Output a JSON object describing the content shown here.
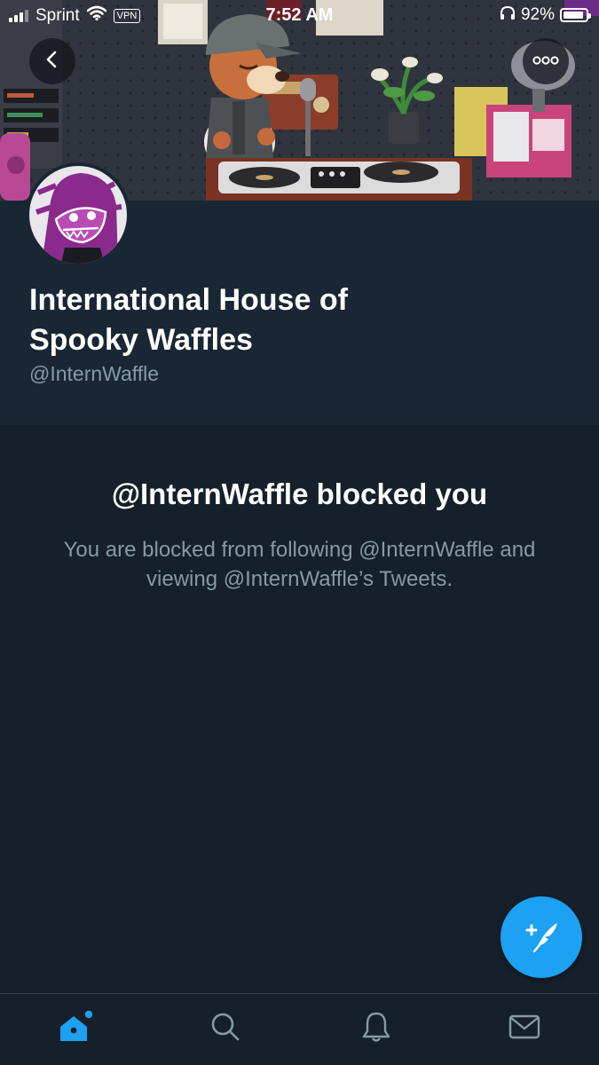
{
  "status_bar": {
    "carrier": "Sprint",
    "vpn_label": "VPN",
    "time": "7:52 AM",
    "battery_percent": "92%",
    "battery_level": 0.92
  },
  "profile": {
    "display_name": "International House of Spooky Waffles",
    "handle": "@InternWaffle"
  },
  "blocked": {
    "title": "@InternWaffle blocked you",
    "description": "You are blocked from following @InternWaffle and viewing @InternWaffle’s Tweets."
  },
  "icons": {
    "back": "chevron-left-icon",
    "more": "more-horizontal-icon",
    "compose": "compose-tweet-icon",
    "home": "home-icon",
    "search": "search-icon",
    "notifications": "bell-icon",
    "messages": "envelope-icon"
  },
  "colors": {
    "background": "#15202b",
    "profile_background": "#192734",
    "accent": "#1da1f2",
    "secondary_text": "#8899a6",
    "avatar_accent": "#8a2a8c"
  }
}
